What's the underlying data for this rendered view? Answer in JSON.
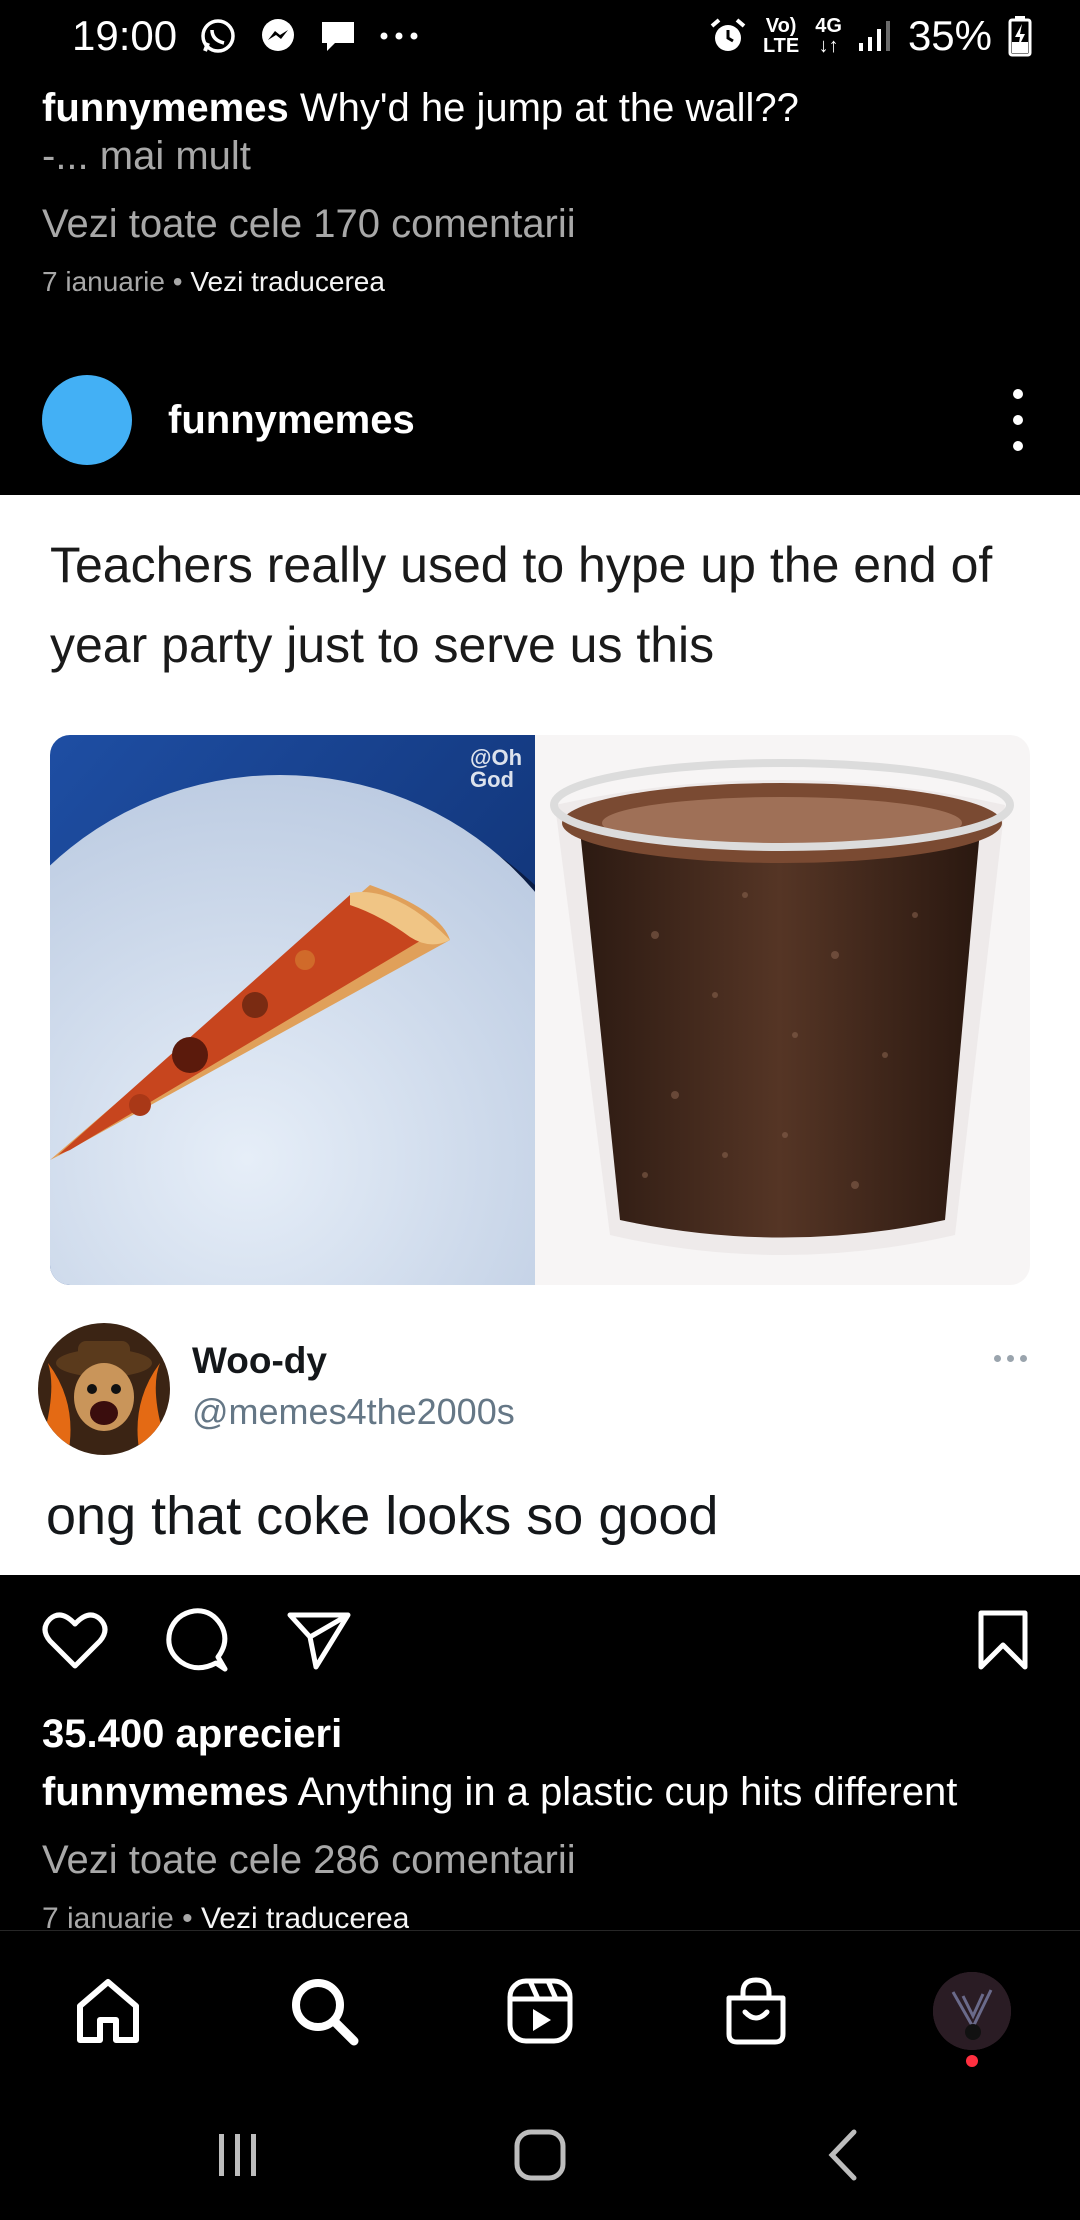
{
  "status_bar": {
    "time": "19:00",
    "network_top": "Vo)",
    "network_bottom": "LTE",
    "gen": "4G",
    "battery": "35%",
    "icons": [
      "whatsapp-icon",
      "messenger-icon",
      "chat-icon",
      "more-dots-icon",
      "alarm-icon",
      "signal-icon",
      "battery-charging-icon"
    ]
  },
  "previous_post": {
    "username": "funnymemes",
    "caption": "Why'd he jump at the wall??",
    "more": "-... mai mult",
    "comments": "Vezi toate cele 170 comentarii",
    "date": "7 ianuarie",
    "separator": " • ",
    "translate": "Vezi traducerea"
  },
  "post": {
    "username": "funnymemes",
    "meme_text": "Teachers really used to hype up the end of year party just to serve us this",
    "watermark": "@Oh God",
    "tweet": {
      "name": "Woo-dy",
      "handle": "@memes4the2000s",
      "text": "ong that coke looks so good"
    },
    "likes": "35.400 aprecieri",
    "caption_user": "funnymemes",
    "caption": "Anything in a plastic cup hits different",
    "comments": "Vezi toate cele 286 comentarii",
    "date": "7 ianuarie",
    "separator": " • ",
    "translate": "Vezi traducerea"
  },
  "actions": [
    "heart-icon",
    "comment-icon",
    "share-icon",
    "bookmark-icon"
  ],
  "bottom_nav": [
    "home-icon",
    "search-icon",
    "reels-icon",
    "shop-icon",
    "profile-avatar"
  ],
  "colors": {
    "background": "#000000",
    "muted": "#a8a8a8",
    "avatar_blue": "#43b0f5",
    "notification": "#ff3040"
  }
}
